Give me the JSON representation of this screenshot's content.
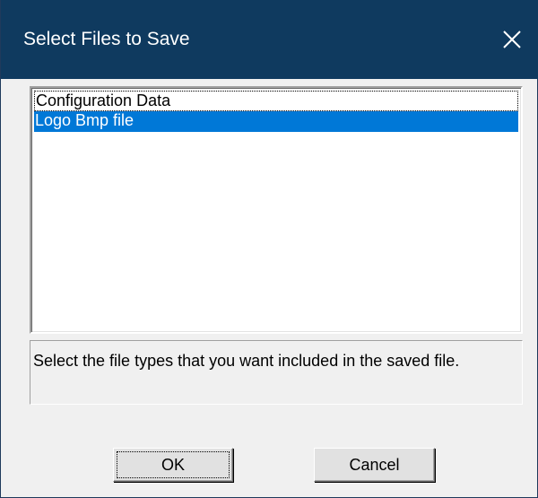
{
  "window": {
    "title": "Select Files to Save",
    "close_icon": "close-icon"
  },
  "file_list": {
    "items": [
      {
        "label": "Configuration Data",
        "selected": false,
        "focused": true
      },
      {
        "label": "Logo Bmp file",
        "selected": true,
        "focused": false
      }
    ]
  },
  "description": {
    "text": "Select the file types that you want included in the saved file."
  },
  "buttons": {
    "ok_label": "OK",
    "cancel_label": "Cancel"
  },
  "colors": {
    "titlebar": "#0f3a5f",
    "selection": "#0078d7",
    "dialog_bg": "#f0f0f0"
  }
}
